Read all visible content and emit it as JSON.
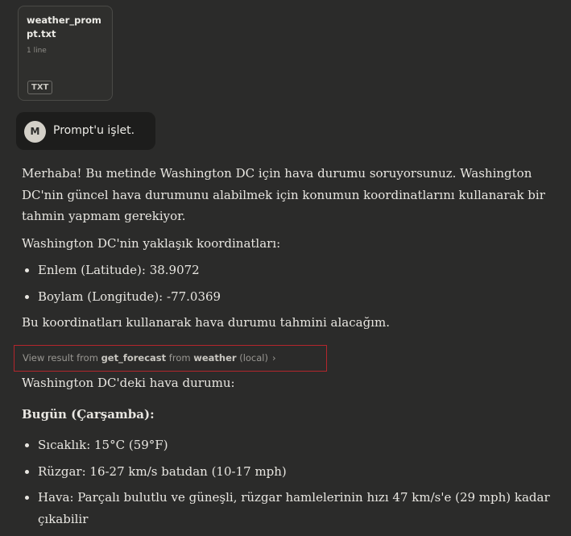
{
  "attachment": {
    "filename": "weather_prompt.txt",
    "lines": "1 line",
    "type": "TXT"
  },
  "user_message": {
    "avatar_initial": "M",
    "text": "Prompt'u işlet."
  },
  "response": {
    "intro": "Merhaba! Bu metinde Washington DC için hava durumu soruyorsunuz. Washington DC'nin güncel hava durumunu alabilmek için konumun koordinatlarını kullanarak bir tahmin yapmam gerekiyor.",
    "coords_heading": "Washington DC'nin yaklaşık koordinatları:",
    "coords": [
      "Enlem (Latitude): 38.9072",
      "Boylam (Longitude): -77.0369"
    ],
    "fetch_note": "Bu koordinatları kullanarak hava durumu tahmini alacağım."
  },
  "tool_call": {
    "prefix": "View result from ",
    "tool_name": "get_forecast",
    "middle": " from ",
    "server": "weather",
    "suffix": " (local)",
    "chevron": "›"
  },
  "forecast": {
    "heading": "Washington DC'deki hava durumu:",
    "day": "Bugün (Çarşamba):",
    "items": [
      "Sıcaklık: 15°C (59°F)",
      "Rüzgar: 16-27 km/s batıdan (10-17 mph)",
      "Hava: Parçalı bulutlu ve güneşli, rüzgar hamlelerinin hızı 47 km/s'e (29 mph) kadar çıkabilir"
    ]
  }
}
